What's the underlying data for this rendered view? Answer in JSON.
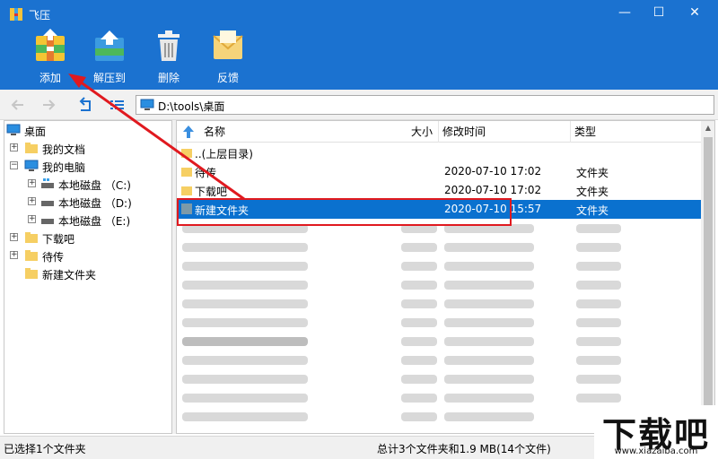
{
  "window": {
    "title": "飞压",
    "min": "—",
    "max": "☐",
    "close": "✕"
  },
  "toolbar": [
    {
      "label": "添加"
    },
    {
      "label": "解压到"
    },
    {
      "label": "删除"
    },
    {
      "label": "反馈"
    }
  ],
  "address": {
    "path": "D:\\tools\\桌面"
  },
  "tree": {
    "items": [
      {
        "label": "桌面"
      },
      {
        "label": "我的文档"
      },
      {
        "label": "我的电脑"
      },
      {
        "label": "本地磁盘 （C:)"
      },
      {
        "label": "本地磁盘 （D:)"
      },
      {
        "label": "本地磁盘 （E:)"
      },
      {
        "label": "下载吧"
      },
      {
        "label": "待传"
      },
      {
        "label": "新建文件夹"
      }
    ]
  },
  "list": {
    "columns": {
      "name": "名称",
      "size": "大小",
      "modified": "修改时间",
      "type": "类型"
    },
    "rows": [
      {
        "name": "..(上层目录)",
        "modified": "",
        "type": ""
      },
      {
        "name": "待传",
        "modified": "2020-07-10 17:02",
        "type": "文件夹"
      },
      {
        "name": "下载吧",
        "modified": "2020-07-10 17:02",
        "type": "文件夹"
      },
      {
        "name": "新建文件夹",
        "modified": "2020-07-10 15:57",
        "type": "文件夹"
      }
    ]
  },
  "status": {
    "left": "已选择1个文件夹",
    "right": "总计3个文件夹和1.9 MB(14个文件)"
  },
  "watermark": {
    "text": "下载吧",
    "url": "www.xiazaiba.com"
  },
  "colors": {
    "header": "#1b72d0",
    "selection": "#0a71cf",
    "annotation": "#e0191f"
  }
}
